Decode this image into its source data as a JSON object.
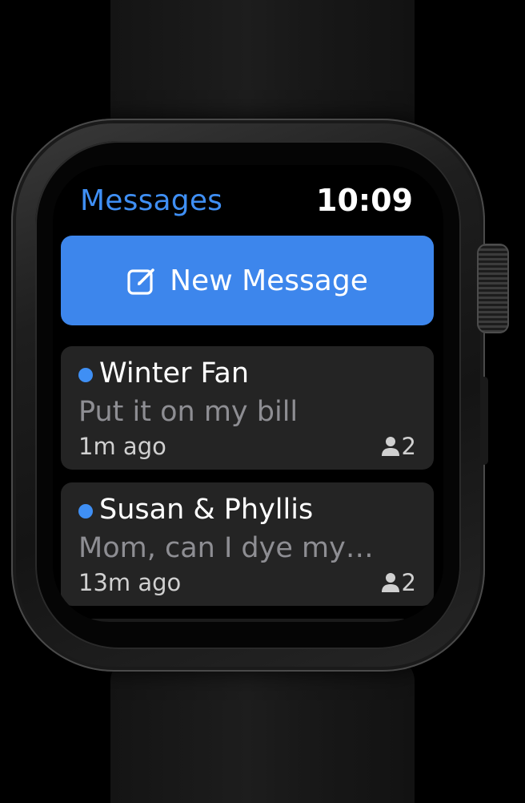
{
  "header": {
    "title": "Messages",
    "time": "10:09"
  },
  "new_message": {
    "label": "New Message",
    "icon": "compose-icon"
  },
  "conversations": [
    {
      "sender": "Winter Fan",
      "preview": "Put it on my bill",
      "time_ago": "1m ago",
      "participants": "2",
      "unread": true
    },
    {
      "sender": "Susan & Phyllis",
      "preview": "Mom, can I dye my…",
      "time_ago": "13m ago",
      "participants": "2",
      "unread": true
    }
  ],
  "colors": {
    "accent": "#3f8ff4",
    "button": "#3d86ec",
    "card": "#242424",
    "secondary_text": "#8e8e93"
  }
}
